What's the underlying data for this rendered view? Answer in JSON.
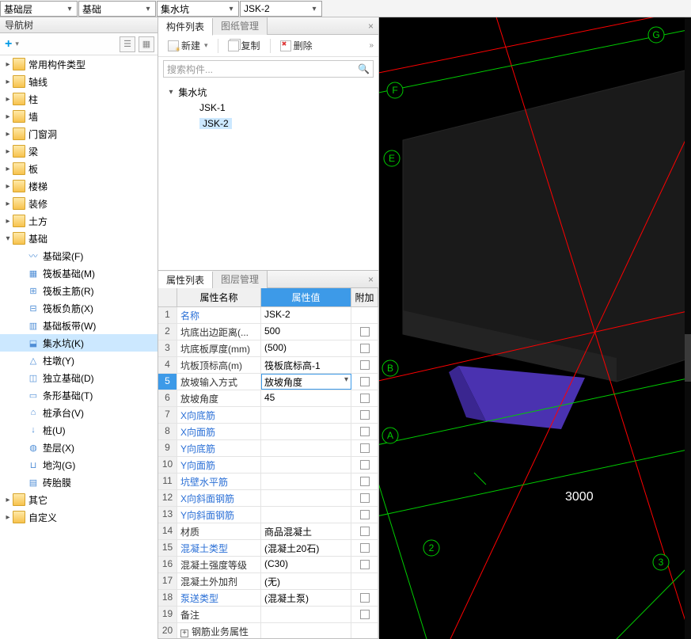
{
  "topbar": {
    "combo0": "基础层",
    "combo1": "基础",
    "combo2": "集水坑",
    "combo3": "JSK-2"
  },
  "nav": {
    "title": "导航树",
    "plus": "+",
    "items": {
      "common": "常用构件类型",
      "axis": "轴线",
      "column": "柱",
      "wall": "墙",
      "doorwin": "门窗洞",
      "beam": "梁",
      "slab": "板",
      "stair": "楼梯",
      "decor": "装修",
      "earth": "土方",
      "foundation": "基础",
      "sub": {
        "jcl": "基础梁(F)",
        "fbjc": "筏板基础(M)",
        "fbzj": "筏板主筋(R)",
        "fbfj": "筏板负筋(X)",
        "jcbd": "基础板带(W)",
        "jsk": "集水坑(K)",
        "zd": "柱墩(Y)",
        "dljc": "独立基础(D)",
        "txjc": "条形基础(T)",
        "zct": "桩承台(V)",
        "z": "桩(U)",
        "dc": "垫层(X)",
        "dg": "地沟(G)",
        "ztm": "砖胎膜"
      },
      "other": "其它",
      "custom": "自定义"
    }
  },
  "componentList": {
    "tab_list": "构件列表",
    "tab_draw": "图纸管理",
    "btn_new": "新建",
    "btn_copy": "复制",
    "btn_del": "删除",
    "search_placeholder": "搜索构件...",
    "root": "集水坑",
    "items": [
      "JSK-1",
      "JSK-2"
    ],
    "selected": "JSK-2"
  },
  "props": {
    "tab_prop": "属性列表",
    "tab_layer": "图层管理",
    "header_name": "属性名称",
    "header_value": "属性值",
    "header_add": "附加",
    "rows": [
      {
        "i": "1",
        "name": "名称",
        "val": "JSK-2",
        "link": true,
        "chk": false
      },
      {
        "i": "2",
        "name": "坑底出边距离(...",
        "val": "500",
        "chk": true
      },
      {
        "i": "3",
        "name": "坑底板厚度(mm)",
        "val": "(500)",
        "chk": true
      },
      {
        "i": "4",
        "name": "坑板顶标高(m)",
        "val": "筏板底标高-1",
        "chk": true
      },
      {
        "i": "5",
        "name": "放坡输入方式",
        "val": "放坡角度",
        "chk": true,
        "selected": true,
        "dropdown": true
      },
      {
        "i": "6",
        "name": "放坡角度",
        "val": "45",
        "chk": true
      },
      {
        "i": "7",
        "name": "X向底筋",
        "val": "",
        "link": true,
        "chk": true
      },
      {
        "i": "8",
        "name": "X向面筋",
        "val": "",
        "link": true,
        "chk": true
      },
      {
        "i": "9",
        "name": "Y向底筋",
        "val": "",
        "link": true,
        "chk": true
      },
      {
        "i": "10",
        "name": "Y向面筋",
        "val": "",
        "link": true,
        "chk": true
      },
      {
        "i": "11",
        "name": "坑壁水平筋",
        "val": "",
        "link": true,
        "chk": true
      },
      {
        "i": "12",
        "name": "X向斜面钢筋",
        "val": "",
        "link": true,
        "chk": true
      },
      {
        "i": "13",
        "name": "Y向斜面钢筋",
        "val": "",
        "link": true,
        "chk": true
      },
      {
        "i": "14",
        "name": "材质",
        "val": "商品混凝土",
        "chk": true
      },
      {
        "i": "15",
        "name": "混凝土类型",
        "val": "(混凝土20石)",
        "link": true,
        "chk": true
      },
      {
        "i": "16",
        "name": "混凝土强度等级",
        "val": "(C30)",
        "chk": true
      },
      {
        "i": "17",
        "name": "混凝土外加剂",
        "val": "(无)",
        "chk": false
      },
      {
        "i": "18",
        "name": "泵送类型",
        "val": "(混凝土泵)",
        "link": true,
        "chk": true
      },
      {
        "i": "19",
        "name": "备注",
        "val": "",
        "chk": true
      },
      {
        "i": "20",
        "name": "钢筋业务属性",
        "val": "",
        "expand": true,
        "chk": false
      }
    ]
  },
  "viewport": {
    "bubbles_letters": [
      "G",
      "F",
      "E",
      "B",
      "A"
    ],
    "bubbles_numbers": [
      "2",
      "3"
    ],
    "dim_label": "3000"
  }
}
